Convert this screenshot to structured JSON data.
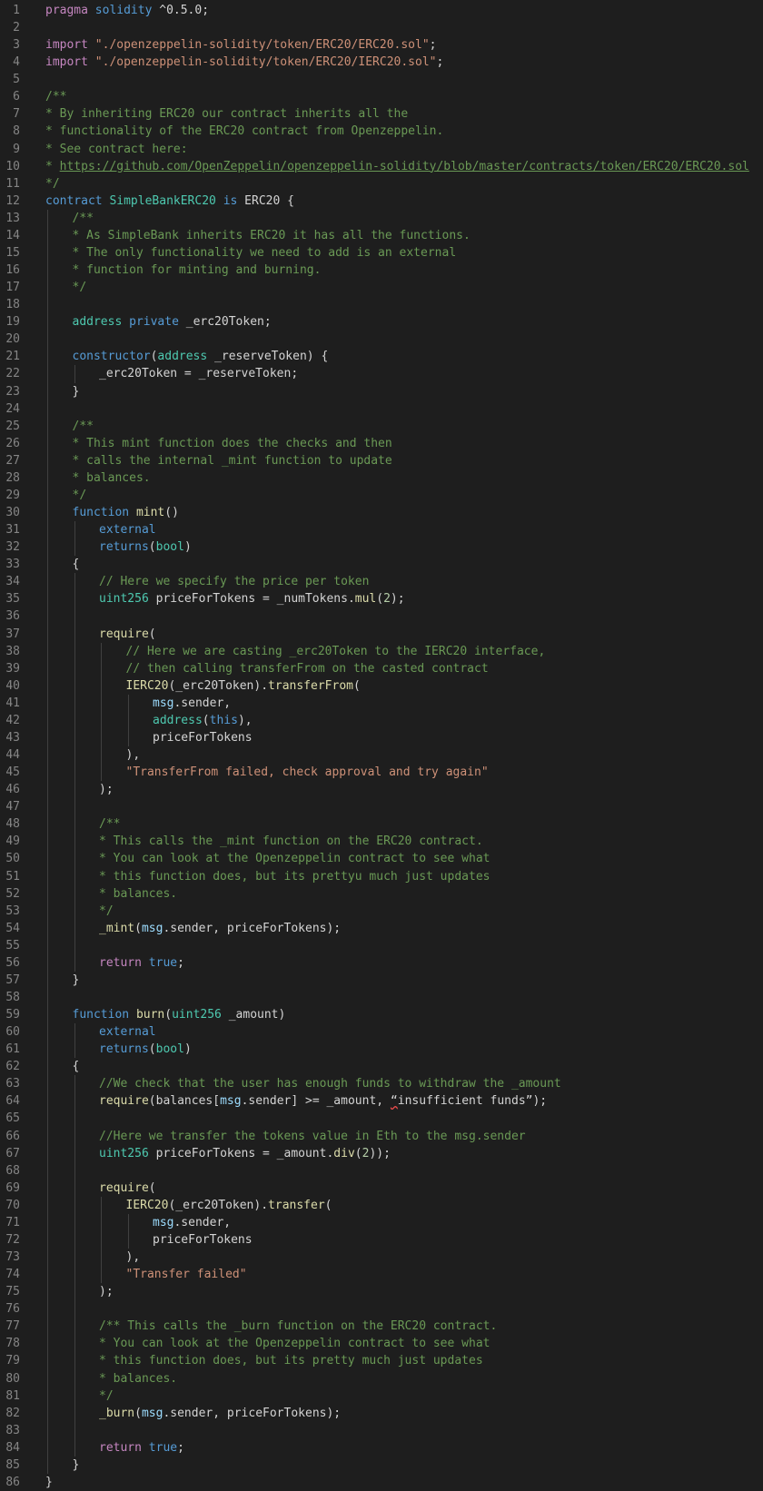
{
  "editor": {
    "language": "solidity",
    "theme": "dark",
    "colors": {
      "background": "#1e1e1e",
      "line_number": "#858585",
      "keyword_blue": "#569cd6",
      "keyword_purple": "#c586c0",
      "type": "#4ec9b0",
      "function": "#dcdcaa",
      "string": "#ce9178",
      "comment": "#6a9955",
      "variable": "#9cdcfe",
      "number": "#b5cea8",
      "text": "#d4d4d4"
    },
    "lines": [
      {
        "n": "1",
        "indent": 0,
        "tokens": [
          [
            "kw",
            "pragma"
          ],
          [
            "pl",
            " "
          ],
          [
            "kb",
            "solidity"
          ],
          [
            "pl",
            " ^0.5.0;"
          ]
        ]
      },
      {
        "n": "2",
        "indent": 0,
        "tokens": []
      },
      {
        "n": "3",
        "indent": 0,
        "tokens": [
          [
            "kw",
            "import"
          ],
          [
            "pl",
            " "
          ],
          [
            "st",
            "\"./openzeppelin-solidity/token/ERC20/ERC20.sol\""
          ],
          [
            "pl",
            ";"
          ]
        ]
      },
      {
        "n": "4",
        "indent": 0,
        "tokens": [
          [
            "kw",
            "import"
          ],
          [
            "pl",
            " "
          ],
          [
            "st",
            "\"./openzeppelin-solidity/token/ERC20/IERC20.sol\""
          ],
          [
            "pl",
            ";"
          ]
        ]
      },
      {
        "n": "5",
        "indent": 0,
        "tokens": []
      },
      {
        "n": "6",
        "indent": 0,
        "tokens": [
          [
            "cm",
            "/**"
          ]
        ]
      },
      {
        "n": "7",
        "indent": 0,
        "tokens": [
          [
            "cm",
            "* By inheriting ERC20 our contract inherits all the"
          ]
        ]
      },
      {
        "n": "8",
        "indent": 0,
        "tokens": [
          [
            "cm",
            "* functionality of the ERC20 contract from Openzeppelin."
          ]
        ]
      },
      {
        "n": "9",
        "indent": 0,
        "tokens": [
          [
            "cm",
            "* See contract here:"
          ]
        ]
      },
      {
        "n": "10",
        "indent": 0,
        "tokens": [
          [
            "cm",
            "* "
          ],
          [
            "lnk",
            "https://github.com/OpenZeppelin/openzeppelin-solidity/blob/master/contracts/token/ERC20/ERC20.sol"
          ]
        ]
      },
      {
        "n": "11",
        "indent": 0,
        "tokens": [
          [
            "cm",
            "*/"
          ]
        ]
      },
      {
        "n": "12",
        "indent": 0,
        "tokens": [
          [
            "kb",
            "contract"
          ],
          [
            "pl",
            " "
          ],
          [
            "ty",
            "SimpleBankERC20"
          ],
          [
            "pl",
            " "
          ],
          [
            "kb",
            "is"
          ],
          [
            "pl",
            " ERC20 {"
          ]
        ]
      },
      {
        "n": "13",
        "indent": 1,
        "tokens": [
          [
            "cm",
            "/**"
          ]
        ]
      },
      {
        "n": "14",
        "indent": 1,
        "tokens": [
          [
            "cm",
            "* As SimpleBank inherits ERC20 it has all the functions."
          ]
        ]
      },
      {
        "n": "15",
        "indent": 1,
        "tokens": [
          [
            "cm",
            "* The only functionality we need to add is an external"
          ]
        ]
      },
      {
        "n": "16",
        "indent": 1,
        "tokens": [
          [
            "cm",
            "* function for minting and burning."
          ]
        ]
      },
      {
        "n": "17",
        "indent": 1,
        "tokens": [
          [
            "cm",
            "*/"
          ]
        ]
      },
      {
        "n": "18",
        "indent": 1,
        "tokens": []
      },
      {
        "n": "19",
        "indent": 1,
        "tokens": [
          [
            "ty",
            "address"
          ],
          [
            "pl",
            " "
          ],
          [
            "kb",
            "private"
          ],
          [
            "pl",
            " _erc20Token;"
          ]
        ]
      },
      {
        "n": "20",
        "indent": 1,
        "tokens": []
      },
      {
        "n": "21",
        "indent": 1,
        "tokens": [
          [
            "kb",
            "constructor"
          ],
          [
            "pl",
            "("
          ],
          [
            "ty",
            "address"
          ],
          [
            "pl",
            " _reserveToken) {"
          ]
        ]
      },
      {
        "n": "22",
        "indent": 2,
        "tokens": [
          [
            "pl",
            "_erc20Token = _reserveToken;"
          ]
        ]
      },
      {
        "n": "23",
        "indent": 1,
        "tokens": [
          [
            "pl",
            "}"
          ]
        ]
      },
      {
        "n": "24",
        "indent": 1,
        "tokens": []
      },
      {
        "n": "25",
        "indent": 1,
        "tokens": [
          [
            "cm",
            "/**"
          ]
        ]
      },
      {
        "n": "26",
        "indent": 1,
        "tokens": [
          [
            "cm",
            "* This mint function does the checks and then"
          ]
        ]
      },
      {
        "n": "27",
        "indent": 1,
        "tokens": [
          [
            "cm",
            "* calls the internal _mint function to update"
          ]
        ]
      },
      {
        "n": "28",
        "indent": 1,
        "tokens": [
          [
            "cm",
            "* balances."
          ]
        ]
      },
      {
        "n": "29",
        "indent": 1,
        "tokens": [
          [
            "cm",
            "*/"
          ]
        ]
      },
      {
        "n": "30",
        "indent": 1,
        "tokens": [
          [
            "kb",
            "function"
          ],
          [
            "pl",
            " "
          ],
          [
            "fn",
            "mint"
          ],
          [
            "pl",
            "()"
          ]
        ]
      },
      {
        "n": "31",
        "indent": 2,
        "tokens": [
          [
            "kb",
            "external"
          ]
        ]
      },
      {
        "n": "32",
        "indent": 2,
        "tokens": [
          [
            "kb",
            "returns"
          ],
          [
            "pl",
            "("
          ],
          [
            "ty",
            "bool"
          ],
          [
            "pl",
            ")"
          ]
        ]
      },
      {
        "n": "33",
        "indent": 1,
        "tokens": [
          [
            "pl",
            "{"
          ]
        ]
      },
      {
        "n": "34",
        "indent": 2,
        "tokens": [
          [
            "cm",
            "// Here we specify the price per token"
          ]
        ]
      },
      {
        "n": "35",
        "indent": 2,
        "tokens": [
          [
            "ty",
            "uint256"
          ],
          [
            "pl",
            " priceForTokens = _numTokens."
          ],
          [
            "fn",
            "mul"
          ],
          [
            "pl",
            "("
          ],
          [
            "nm",
            "2"
          ],
          [
            "pl",
            ");"
          ]
        ]
      },
      {
        "n": "36",
        "indent": 2,
        "tokens": []
      },
      {
        "n": "37",
        "indent": 2,
        "tokens": [
          [
            "fn",
            "require"
          ],
          [
            "pl",
            "("
          ]
        ]
      },
      {
        "n": "38",
        "indent": 3,
        "tokens": [
          [
            "cm",
            "// Here we are casting _erc20Token to the IERC20 interface,"
          ]
        ]
      },
      {
        "n": "39",
        "indent": 3,
        "tokens": [
          [
            "cm",
            "// then calling transferFrom on the casted contract"
          ]
        ]
      },
      {
        "n": "40",
        "indent": 3,
        "tokens": [
          [
            "fn",
            "IERC20"
          ],
          [
            "pl",
            "(_erc20Token)."
          ],
          [
            "fn",
            "transferFrom"
          ],
          [
            "pl",
            "("
          ]
        ]
      },
      {
        "n": "41",
        "indent": 4,
        "tokens": [
          [
            "vr",
            "msg"
          ],
          [
            "pl",
            ".sender,"
          ]
        ]
      },
      {
        "n": "42",
        "indent": 4,
        "tokens": [
          [
            "ty",
            "address"
          ],
          [
            "pl",
            "("
          ],
          [
            "kb",
            "this"
          ],
          [
            "pl",
            "),"
          ]
        ]
      },
      {
        "n": "43",
        "indent": 4,
        "tokens": [
          [
            "pl",
            "priceForTokens"
          ]
        ]
      },
      {
        "n": "44",
        "indent": 3,
        "tokens": [
          [
            "pl",
            "),"
          ]
        ]
      },
      {
        "n": "45",
        "indent": 3,
        "tokens": [
          [
            "st",
            "\"TransferFrom failed, check approval and try again\""
          ]
        ]
      },
      {
        "n": "46",
        "indent": 2,
        "tokens": [
          [
            "pl",
            ");"
          ]
        ]
      },
      {
        "n": "47",
        "indent": 2,
        "tokens": []
      },
      {
        "n": "48",
        "indent": 2,
        "tokens": [
          [
            "cm",
            "/**"
          ]
        ]
      },
      {
        "n": "49",
        "indent": 2,
        "tokens": [
          [
            "cm",
            "* This calls the _mint function on the ERC20 contract."
          ]
        ]
      },
      {
        "n": "50",
        "indent": 2,
        "tokens": [
          [
            "cm",
            "* You can look at the Openzeppelin contract to see what"
          ]
        ]
      },
      {
        "n": "51",
        "indent": 2,
        "tokens": [
          [
            "cm",
            "* this function does, but its prettyu much just updates"
          ]
        ]
      },
      {
        "n": "52",
        "indent": 2,
        "tokens": [
          [
            "cm",
            "* balances."
          ]
        ]
      },
      {
        "n": "53",
        "indent": 2,
        "tokens": [
          [
            "cm",
            "*/"
          ]
        ]
      },
      {
        "n": "54",
        "indent": 2,
        "tokens": [
          [
            "fn",
            "_mint"
          ],
          [
            "pl",
            "("
          ],
          [
            "vr",
            "msg"
          ],
          [
            "pl",
            ".sender, priceForTokens);"
          ]
        ]
      },
      {
        "n": "55",
        "indent": 2,
        "tokens": []
      },
      {
        "n": "56",
        "indent": 2,
        "tokens": [
          [
            "kw",
            "return"
          ],
          [
            "pl",
            " "
          ],
          [
            "kb",
            "true"
          ],
          [
            "pl",
            ";"
          ]
        ]
      },
      {
        "n": "57",
        "indent": 1,
        "tokens": [
          [
            "pl",
            "}"
          ]
        ]
      },
      {
        "n": "58",
        "indent": 1,
        "tokens": []
      },
      {
        "n": "59",
        "indent": 1,
        "tokens": [
          [
            "kb",
            "function"
          ],
          [
            "pl",
            " "
          ],
          [
            "fn",
            "burn"
          ],
          [
            "pl",
            "("
          ],
          [
            "ty",
            "uint256"
          ],
          [
            "pl",
            " _amount)"
          ]
        ]
      },
      {
        "n": "60",
        "indent": 2,
        "tokens": [
          [
            "kb",
            "external"
          ]
        ]
      },
      {
        "n": "61",
        "indent": 2,
        "tokens": [
          [
            "kb",
            "returns"
          ],
          [
            "pl",
            "("
          ],
          [
            "ty",
            "bool"
          ],
          [
            "pl",
            ")"
          ]
        ]
      },
      {
        "n": "62",
        "indent": 1,
        "tokens": [
          [
            "pl",
            "{"
          ]
        ]
      },
      {
        "n": "63",
        "indent": 2,
        "tokens": [
          [
            "cm",
            "//We check that the user has enough funds to withdraw the _amount"
          ]
        ]
      },
      {
        "n": "64",
        "indent": 2,
        "tokens": [
          [
            "fn",
            "require"
          ],
          [
            "pl",
            "(balances["
          ],
          [
            "vr",
            "msg"
          ],
          [
            "pl",
            ".sender] >= _amount, "
          ],
          [
            "sq",
            "“"
          ],
          [
            "pl",
            "insufficient funds”);"
          ]
        ]
      },
      {
        "n": "65",
        "indent": 2,
        "tokens": []
      },
      {
        "n": "66",
        "indent": 2,
        "tokens": [
          [
            "cm",
            "//Here we transfer the tokens value in Eth to the msg.sender"
          ]
        ]
      },
      {
        "n": "67",
        "indent": 2,
        "tokens": [
          [
            "ty",
            "uint256"
          ],
          [
            "pl",
            " priceForTokens = _amount."
          ],
          [
            "fn",
            "div"
          ],
          [
            "pl",
            "("
          ],
          [
            "nm",
            "2"
          ],
          [
            "pl",
            "));"
          ]
        ]
      },
      {
        "n": "68",
        "indent": 2,
        "tokens": []
      },
      {
        "n": "69",
        "indent": 2,
        "tokens": [
          [
            "fn",
            "require"
          ],
          [
            "pl",
            "("
          ]
        ]
      },
      {
        "n": "70",
        "indent": 3,
        "tokens": [
          [
            "fn",
            "IERC20"
          ],
          [
            "pl",
            "(_erc20Token)."
          ],
          [
            "fn",
            "transfer"
          ],
          [
            "pl",
            "("
          ]
        ]
      },
      {
        "n": "71",
        "indent": 4,
        "tokens": [
          [
            "vr",
            "msg"
          ],
          [
            "pl",
            ".sender,"
          ]
        ]
      },
      {
        "n": "72",
        "indent": 4,
        "tokens": [
          [
            "pl",
            "priceForTokens"
          ]
        ]
      },
      {
        "n": "73",
        "indent": 3,
        "tokens": [
          [
            "pl",
            "),"
          ]
        ]
      },
      {
        "n": "74",
        "indent": 3,
        "tokens": [
          [
            "st",
            "\"Transfer failed\""
          ]
        ]
      },
      {
        "n": "75",
        "indent": 2,
        "tokens": [
          [
            "pl",
            ");"
          ]
        ]
      },
      {
        "n": "76",
        "indent": 2,
        "tokens": []
      },
      {
        "n": "77",
        "indent": 2,
        "tokens": [
          [
            "cm",
            "/** This calls the _burn function on the ERC20 contract."
          ]
        ]
      },
      {
        "n": "78",
        "indent": 2,
        "tokens": [
          [
            "cm",
            "* You can look at the Openzeppelin contract to see what"
          ]
        ]
      },
      {
        "n": "79",
        "indent": 2,
        "tokens": [
          [
            "cm",
            "* this function does, but its pretty much just updates"
          ]
        ]
      },
      {
        "n": "80",
        "indent": 2,
        "tokens": [
          [
            "cm",
            "* balances."
          ]
        ]
      },
      {
        "n": "81",
        "indent": 2,
        "tokens": [
          [
            "cm",
            "*/"
          ]
        ]
      },
      {
        "n": "82",
        "indent": 2,
        "tokens": [
          [
            "fn",
            "_burn"
          ],
          [
            "pl",
            "("
          ],
          [
            "vr",
            "msg"
          ],
          [
            "pl",
            ".sender, priceForTokens);"
          ]
        ]
      },
      {
        "n": "83",
        "indent": 2,
        "tokens": []
      },
      {
        "n": "84",
        "indent": 2,
        "tokens": [
          [
            "kw",
            "return"
          ],
          [
            "pl",
            " "
          ],
          [
            "kb",
            "true"
          ],
          [
            "pl",
            ";"
          ]
        ]
      },
      {
        "n": "85",
        "indent": 1,
        "tokens": [
          [
            "pl",
            "}"
          ]
        ]
      },
      {
        "n": "86",
        "indent": 0,
        "tokens": [
          [
            "pl",
            "}"
          ]
        ]
      }
    ]
  }
}
